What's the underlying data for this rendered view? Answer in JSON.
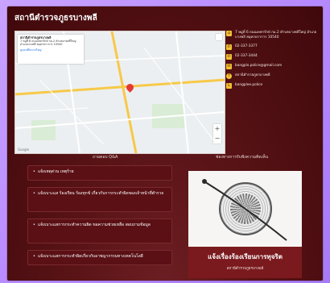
{
  "page": {
    "title": "สถานีตำรวจภูธรบางพลี"
  },
  "map": {
    "place_name": "สถานีตำรวจภูธรบางพลี",
    "place_address": "7 หมู่ที่ 6 ถนนเทพารักษ์ กม.2 ตำบลบางพลีใหญ่ อำเภอบางพลี สมุทรปราการ 10540",
    "link_text": "ดูแผนที่ขนาดใหญ่",
    "zoom_in": "+",
    "zoom_out": "−",
    "attribution": "Google"
  },
  "contacts": {
    "address": "7 หมู่ที่ 6 ถนนเทพารักษ์ กม.2 ตำบลบางพลีใหญ่ อำเภอบางพลี สมุทรปราการ 10540",
    "phone1": "02-337-3377",
    "phone2": "02-337-3444",
    "email": "bangplo.police@gmail.com",
    "facebook": "สถานีตำรวจภูธรบางพลี",
    "line": "bangplee.police"
  },
  "sections": {
    "qa_label": "ถามตอบ Q&A",
    "feedback_label": "ช่องทางการรับฟังความคิดเห็น"
  },
  "qa_items": [
    "แจ้งเหตุด่วน เหตุร้าย",
    "แจ้งเบาะแส ร้องเรียน ร้องทุกข์ เกี่ยวกับการกระทำผิดของเจ้าหน้าที่ตำรวจ",
    "แจ้งเบาะแสการกระทำความผิด ขอความช่วยเหลือ สอบถามข้อมูล",
    "แจ้งเบาะแสการกระทำผิดเกี่ยวกับอาชญากรรมทางเทคโนโลยี"
  ],
  "poster": {
    "title": "แจ้งเรื่องร้องเรียนการทุจริต",
    "subtitle": "สถานีตำรวจภูธรบางพลี"
  }
}
